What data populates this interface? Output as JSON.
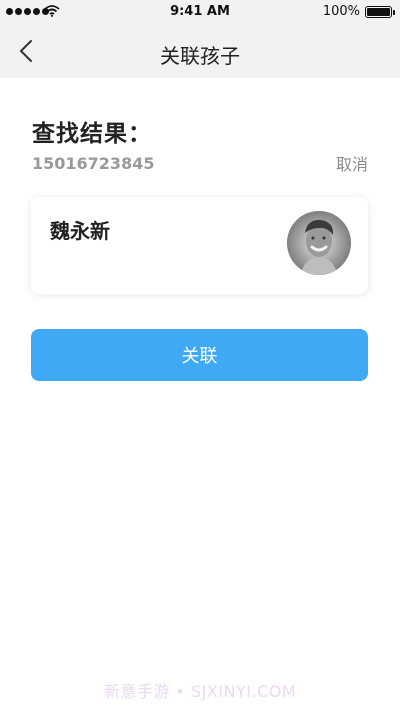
{
  "status_bar": {
    "time": "9:41 AM",
    "battery": "100%"
  },
  "nav": {
    "title": "关联孩子",
    "back_icon": "chevron-left-icon"
  },
  "search_result": {
    "heading": "查找结果：",
    "phone": "15016723845",
    "cancel_label": "取消"
  },
  "child": {
    "name": "魏永新",
    "avatar_icon": "user-avatar"
  },
  "link_button_label": "关联",
  "watermark": "新意手游 • SJXINYI.COM",
  "colors": {
    "accent": "#3fa9f5",
    "header_bg": "#f2f2f2"
  }
}
